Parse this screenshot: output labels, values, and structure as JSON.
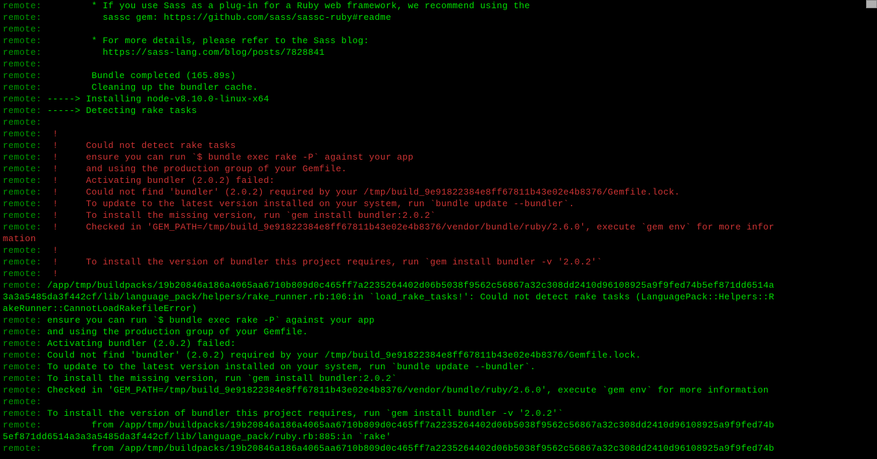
{
  "prefix": "remote: ",
  "lines": [
    {
      "type": "green",
      "indent": "        ",
      "text": "* If you use Sass as a plug-in for a Ruby web framework, we recommend using the"
    },
    {
      "type": "green",
      "indent": "          ",
      "text": "sassc gem: https://github.com/sass/sassc-ruby#readme"
    },
    {
      "type": "green",
      "indent": "",
      "text": ""
    },
    {
      "type": "green",
      "indent": "        ",
      "text": "* For more details, please refer to the Sass blog:"
    },
    {
      "type": "green",
      "indent": "          ",
      "text": "https://sass-lang.com/blog/posts/7828841"
    },
    {
      "type": "green",
      "indent": "",
      "text": ""
    },
    {
      "type": "green",
      "indent": "        ",
      "text": "Bundle completed (165.89s)"
    },
    {
      "type": "green",
      "indent": "        ",
      "text": "Cleaning up the bundler cache."
    },
    {
      "type": "green",
      "indent": "",
      "text": "-----> Installing node-v8.10.0-linux-x64"
    },
    {
      "type": "green",
      "indent": "",
      "text": "-----> Detecting rake tasks"
    },
    {
      "type": "green",
      "indent": "",
      "text": ""
    },
    {
      "type": "red",
      "indent": " !     ",
      "text": ""
    },
    {
      "type": "red",
      "indent": " !     ",
      "text": "Could not detect rake tasks"
    },
    {
      "type": "red",
      "indent": " !     ",
      "text": "ensure you can run `$ bundle exec rake -P` against your app"
    },
    {
      "type": "red",
      "indent": " !     ",
      "text": "and using the production group of your Gemfile."
    },
    {
      "type": "red",
      "indent": " !     ",
      "text": "Activating bundler (2.0.2) failed:"
    },
    {
      "type": "red",
      "indent": " !     ",
      "text": "Could not find 'bundler' (2.0.2) required by your /tmp/build_9e91822384e8ff67811b43e02e4b8376/Gemfile.lock."
    },
    {
      "type": "red",
      "indent": " !     ",
      "text": "To update to the latest version installed on your system, run `bundle update --bundler`."
    },
    {
      "type": "red",
      "indent": " !     ",
      "text": "To install the missing version, run `gem install bundler:2.0.2`"
    },
    {
      "type": "red-wrap",
      "indent": " !     ",
      "text": "Checked in 'GEM_PATH=/tmp/build_9e91822384e8ff67811b43e02e4b8376/vendor/bundle/ruby/2.6.0', execute `gem env` for more infor",
      "wrap": "mation"
    },
    {
      "type": "red",
      "indent": " !     ",
      "text": ""
    },
    {
      "type": "red",
      "indent": " !     ",
      "text": "To install the version of bundler this project requires, run `gem install bundler -v '2.0.2'`"
    },
    {
      "type": "red",
      "indent": " !",
      "text": ""
    },
    {
      "type": "green-wrap3",
      "text": "/app/tmp/buildpacks/19b20846a186a4065aa6710b809d0c465ff7a2235264402d06b5038f9562c56867a32c308dd2410d96108925a9f9fed74b5ef871dd6514a",
      "wrap1": "3a3a5485da3f442cf/lib/language_pack/helpers/rake_runner.rb:106:in `load_rake_tasks!': Could not detect rake tasks (LanguagePack::Helpers::R",
      "wrap2": "akeRunner::CannotLoadRakefileError)"
    },
    {
      "type": "green",
      "indent": "",
      "text": "ensure you can run `$ bundle exec rake -P` against your app"
    },
    {
      "type": "green",
      "indent": "",
      "text": "and using the production group of your Gemfile."
    },
    {
      "type": "green",
      "indent": "",
      "text": "Activating bundler (2.0.2) failed:"
    },
    {
      "type": "green",
      "indent": "",
      "text": "Could not find 'bundler' (2.0.2) required by your /tmp/build_9e91822384e8ff67811b43e02e4b8376/Gemfile.lock."
    },
    {
      "type": "green",
      "indent": "",
      "text": "To update to the latest version installed on your system, run `bundle update --bundler`."
    },
    {
      "type": "green",
      "indent": "",
      "text": "To install the missing version, run `gem install bundler:2.0.2`"
    },
    {
      "type": "green",
      "indent": "",
      "text": "Checked in 'GEM_PATH=/tmp/build_9e91822384e8ff67811b43e02e4b8376/vendor/bundle/ruby/2.6.0', execute `gem env` for more information"
    },
    {
      "type": "green",
      "indent": "",
      "text": ""
    },
    {
      "type": "green",
      "indent": "",
      "text": "To install the version of bundler this project requires, run `gem install bundler -v '2.0.2'`"
    },
    {
      "type": "green-wrap2",
      "indent": "        ",
      "text": "from /app/tmp/buildpacks/19b20846a186a4065aa6710b809d0c465ff7a2235264402d06b5038f9562c56867a32c308dd2410d96108925a9f9fed74b",
      "wrap": "5ef871dd6514a3a3a5485da3f442cf/lib/language_pack/ruby.rb:885:in `rake'"
    },
    {
      "type": "green-partial",
      "indent": "        ",
      "text": "from /app/tmp/buildpacks/19b20846a186a4065aa6710b809d0c465ff7a2235264402d06b5038f9562c56867a32c308dd2410d96108925a9f9fed74b"
    }
  ]
}
